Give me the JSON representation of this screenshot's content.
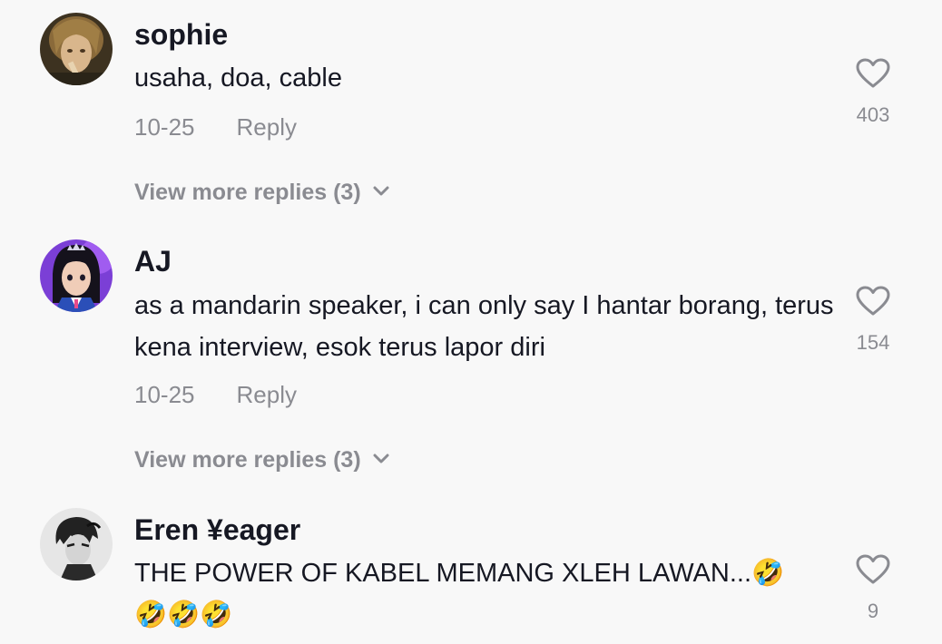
{
  "comments": [
    {
      "username": "sophie",
      "text": "usaha, doa, cable",
      "date": "10-25",
      "reply_label": "Reply",
      "view_more_label": "View more replies (3)",
      "likes": "403"
    },
    {
      "username": "AJ",
      "text": "as a mandarin speaker, i can only say I hantar borang, terus kena interview, esok terus lapor diri",
      "date": "10-25",
      "reply_label": "Reply",
      "view_more_label": "View more replies (3)",
      "likes": "154"
    },
    {
      "username": "Eren ¥eager",
      "text": "THE POWER OF KABEL MEMANG XLEH LAWAN...🤣🤣🤣🤣",
      "likes": "9"
    }
  ],
  "colors": {
    "background": "#f8f8f8",
    "primary_text": "#161823",
    "secondary_text": "#8a8b91"
  },
  "icons": {
    "like": "heart-outline-icon",
    "expand": "chevron-down-icon"
  }
}
